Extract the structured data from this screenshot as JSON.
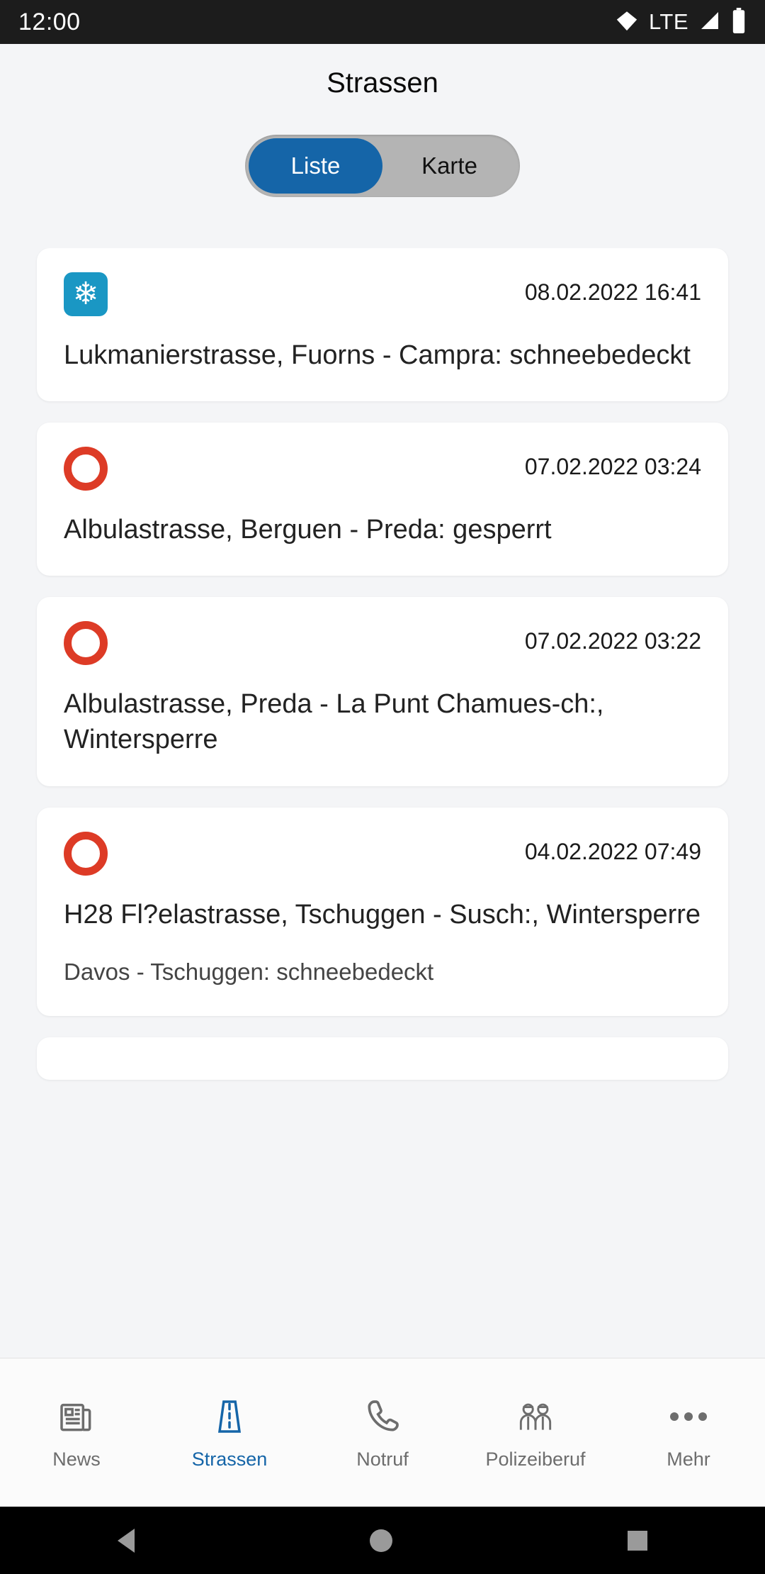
{
  "status_bar": {
    "time": "12:00",
    "network_label": "LTE",
    "wifi_icon": "wifi-icon",
    "signal_icon": "signal-icon",
    "battery_icon": "battery-icon"
  },
  "header": {
    "title": "Strassen"
  },
  "segmented_control": {
    "selected": "Liste",
    "options": [
      {
        "label": "Liste",
        "active": true
      },
      {
        "label": "Karte",
        "active": false
      }
    ],
    "active_color": "#1565a8",
    "track_color": "#b4b4b4"
  },
  "list": {
    "cards": [
      {
        "icon": "snowflake-icon",
        "icon_type": "snow",
        "icon_color": "#1a97c4",
        "date": "08.02.2022 16:41",
        "title": "Lukmanierstrasse,  Fuorns - Campra: schneebedeckt",
        "subtitle": ""
      },
      {
        "icon": "road-closed-icon",
        "icon_type": "closed",
        "icon_color": "#dd3b26",
        "date": "07.02.2022 03:24",
        "title": "Albulastrasse,  Berguen - Preda: gesperrt",
        "subtitle": ""
      },
      {
        "icon": "road-closed-icon",
        "icon_type": "closed",
        "icon_color": "#dd3b26",
        "date": "07.02.2022 03:22",
        "title": "Albulastrasse,  Preda - La Punt Chamues-ch:, Wintersperre",
        "subtitle": ""
      },
      {
        "icon": "road-closed-icon",
        "icon_type": "closed",
        "icon_color": "#dd3b26",
        "date": "04.02.2022 07:49",
        "title": "H28 Fl?elastrasse,  Tschuggen - Susch:, Wintersperre",
        "subtitle": "Davos - Tschuggen: schneebedeckt"
      }
    ]
  },
  "bottom_nav": {
    "active": "Strassen",
    "active_color": "#1565a8",
    "inactive_color": "#6d6d6d",
    "items": [
      {
        "label": "News",
        "icon": "newspaper-icon",
        "active": false
      },
      {
        "label": "Strassen",
        "icon": "road-icon",
        "active": true
      },
      {
        "label": "Notruf",
        "icon": "phone-icon",
        "active": false
      },
      {
        "label": "Polizeiberuf",
        "icon": "police-officers-icon",
        "active": false
      },
      {
        "label": "Mehr",
        "icon": "more-dots-icon",
        "active": false
      }
    ]
  },
  "android_nav": {
    "back": "back-icon",
    "home": "home-icon",
    "recents": "recents-icon"
  }
}
